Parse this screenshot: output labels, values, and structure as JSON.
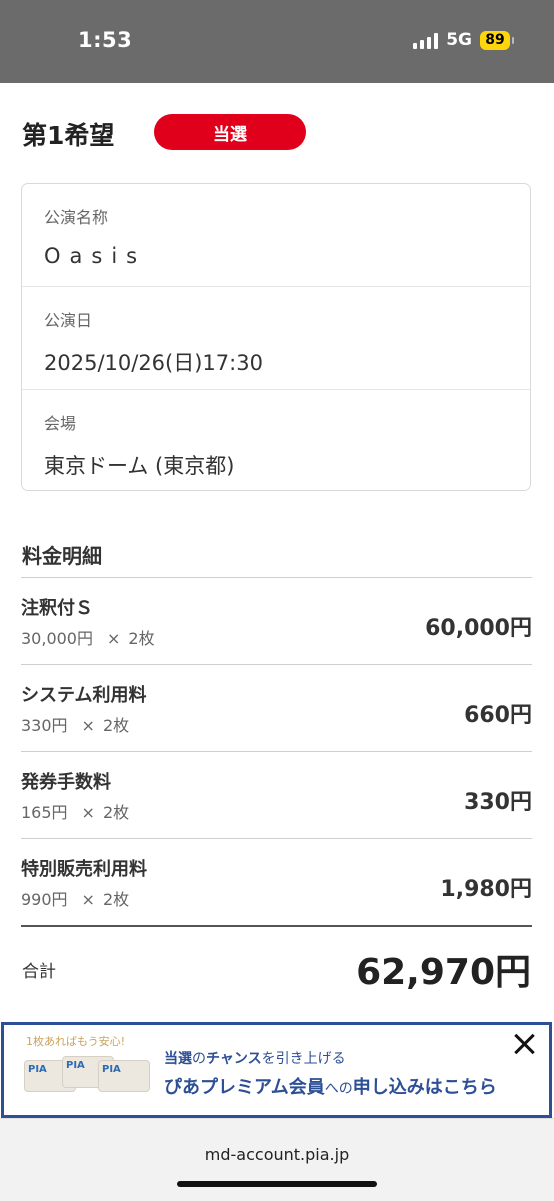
{
  "status_bar": {
    "time": "1:53",
    "network": "5G",
    "battery": "89"
  },
  "header": {
    "choice": "第1希望",
    "badge": "当選"
  },
  "performance": {
    "name_label": "公演名称",
    "name_value": "Oasis",
    "date_label": "公演日",
    "date_value": "2025/10/26(日)17:30",
    "venue_label": "会場",
    "venue_value": "東京ドーム (東京都)"
  },
  "fees": {
    "title": "料金明細",
    "items": [
      {
        "name": "注釈付Ｓ",
        "unit": "30,000円",
        "times": "×",
        "qty": "2枚",
        "amount": "60,000円"
      },
      {
        "name": "システム利用料",
        "unit": "330円",
        "times": "×",
        "qty": "2枚",
        "amount": "660円"
      },
      {
        "name": "発券手数料",
        "unit": "165円",
        "times": "×",
        "qty": "2枚",
        "amount": "330円"
      },
      {
        "name": "特別販売利用料",
        "unit": "990円",
        "times": "×",
        "qty": "2枚",
        "amount": "1,980円"
      }
    ],
    "total_label": "合計",
    "total_amount": "62,970円"
  },
  "banner": {
    "tagline": "1枚あればもう安心!",
    "line1_a": "当選",
    "line1_b": "の",
    "line1_c": "チャンス",
    "line1_d": "を引き上げる",
    "line2_a": "ぴあプレミアム会員",
    "line2_b": "への",
    "line2_c": "申し込みはこちら",
    "card_logo": "PIA"
  },
  "url_bar": {
    "url": "md-account.pia.jp"
  }
}
